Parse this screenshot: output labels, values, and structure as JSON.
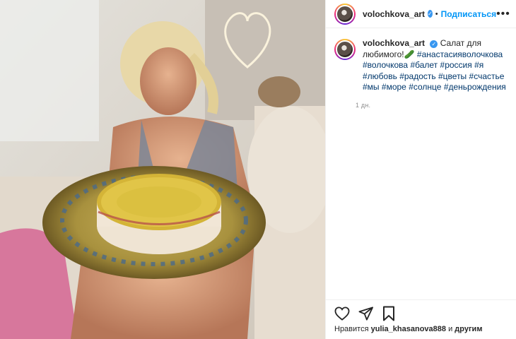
{
  "post": {
    "username": "volochkova_art",
    "verified_mark": "✓",
    "separator": "•",
    "follow_label": "Подписаться",
    "more_label": "•••"
  },
  "caption": {
    "username": "volochkova_art",
    "text": "Салат для любимого!",
    "emoji": "🥒",
    "hashtags": [
      "#анастасияволочкова",
      "#волочкова",
      "#балет",
      "#россия",
      "#я",
      "#любовь",
      "#радость",
      "#цветы",
      "#счастье",
      "#мы",
      "#море",
      "#солнце",
      "#деньрождения"
    ],
    "time": "1 дн."
  },
  "likes": {
    "prefix": "Нравится",
    "user": "yulia_khasanova888",
    "connector": "и",
    "others": "другим"
  },
  "icons": {
    "like": "heart-icon",
    "share": "paper-plane-icon",
    "save": "bookmark-icon"
  }
}
